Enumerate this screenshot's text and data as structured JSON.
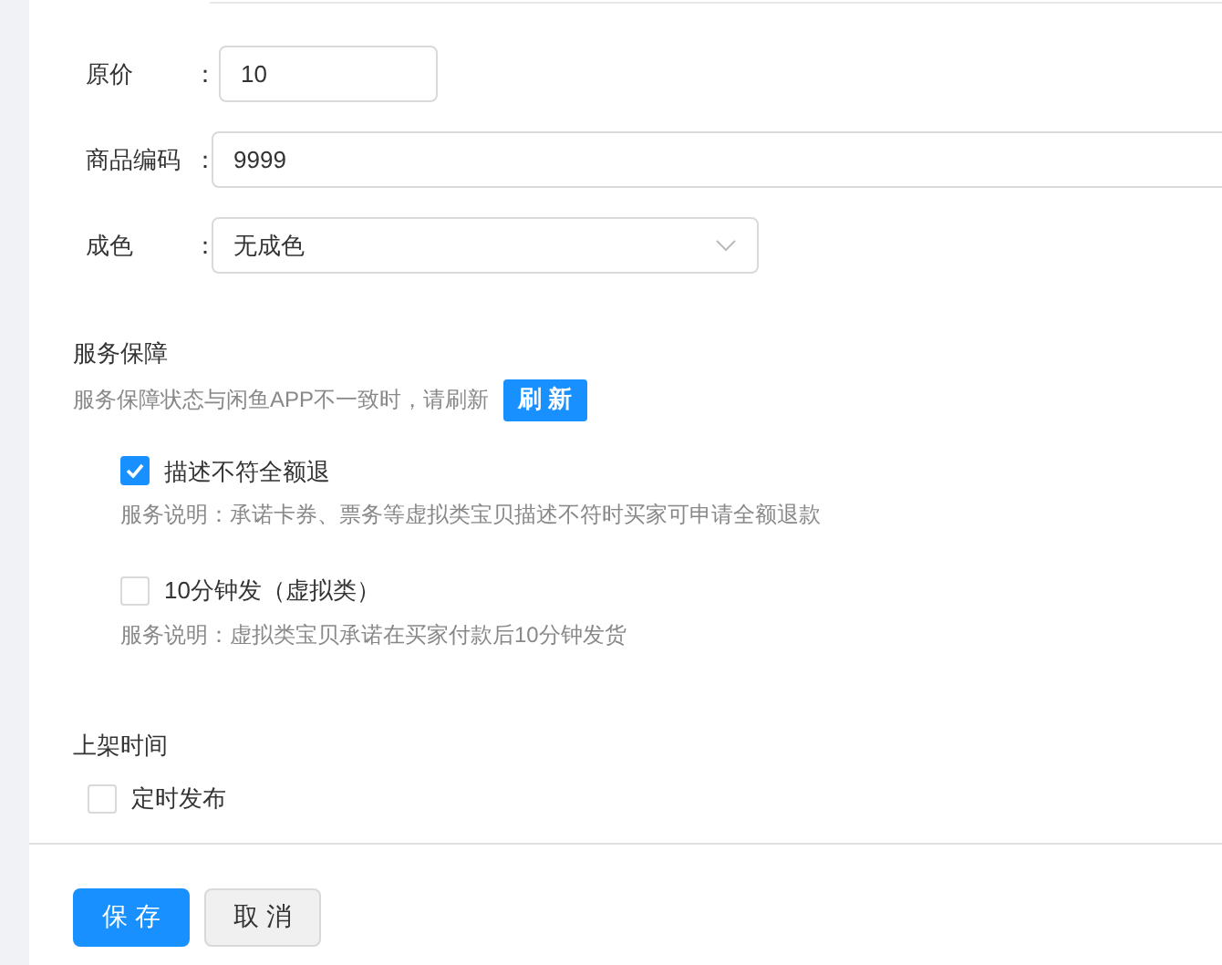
{
  "fields": [
    {
      "kind": "input",
      "label": "原价",
      "colon": "：",
      "value": "10"
    },
    {
      "kind": "input-wide",
      "label": "商品编码",
      "colon": "：",
      "value": "9999"
    },
    {
      "kind": "select",
      "label": "成色",
      "colon": "：",
      "value": "无成色"
    }
  ],
  "service": {
    "title": "服务保障",
    "hint": "服务保障状态与闲鱼APP不一致时，请刷新",
    "refresh": "刷 新",
    "options": [
      {
        "label": "描述不符全额退",
        "checked": true,
        "desc": "服务说明：承诺卡券、票务等虚拟类宝贝描述不符时买家可申请全额退款"
      },
      {
        "label": "10分钟发（虚拟类）",
        "checked": false,
        "desc": "服务说明：虚拟类宝贝承诺在买家付款后10分钟发货"
      }
    ]
  },
  "listing": {
    "title": "上架时间",
    "option": {
      "label": "定时发布",
      "checked": false
    }
  },
  "buttons": [
    {
      "kind": "primary",
      "label": "保 存"
    },
    {
      "kind": "default",
      "label": "取 消"
    }
  ]
}
